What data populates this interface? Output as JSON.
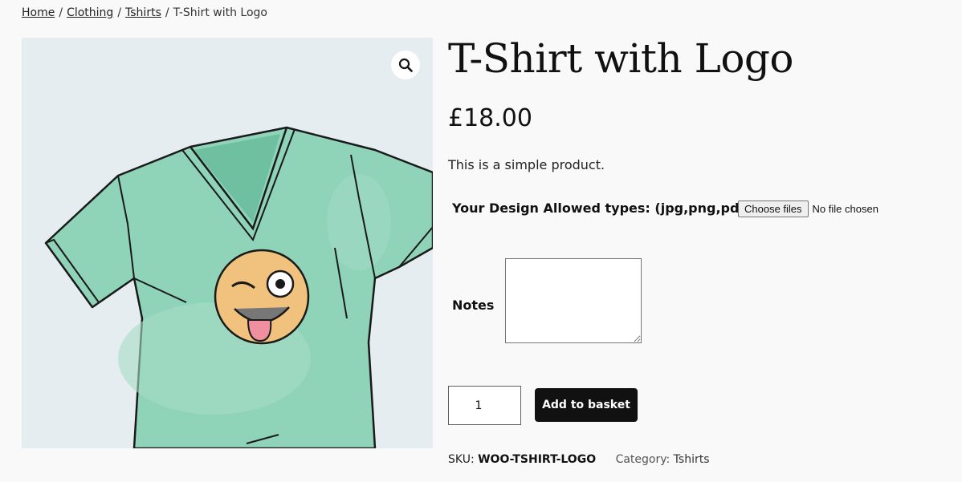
{
  "breadcrumb": {
    "home": "Home",
    "clothing": "Clothing",
    "tshirts": "Tshirts",
    "current": "T-Shirt with Logo",
    "separator": "/"
  },
  "gallery": {
    "zoom_icon": "magnifier-icon",
    "image_alt": "T-Shirt with Logo"
  },
  "product": {
    "title": "T-Shirt with Logo",
    "price": "£18.00",
    "short_description": "This is a simple product."
  },
  "addons": {
    "design_label": "Your Design Allowed types: (jpg,png,pdf)",
    "file_button": "Choose files",
    "file_status": "No file chosen",
    "notes_label": "Notes",
    "notes_value": ""
  },
  "cart": {
    "quantity": "1",
    "add_button": "Add to basket"
  },
  "meta": {
    "sku_label": "SKU:",
    "sku_value": "WOO-TSHIRT-LOGO",
    "category_label": "Category:",
    "category_value": "Tshirts"
  },
  "colors": {
    "shirt": "#8fd3b8",
    "background": "#f9f9f9",
    "button": "#111111"
  }
}
